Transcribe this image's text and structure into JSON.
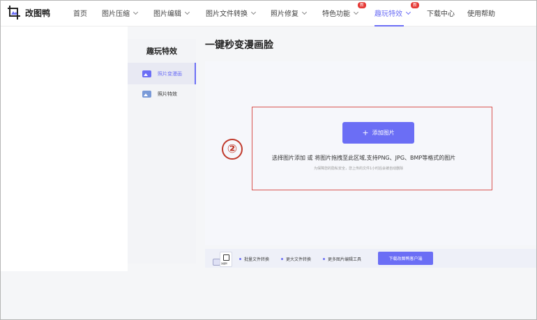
{
  "brand": {
    "name": "改图鸭",
    "logo_icon": "crop-photo-icon"
  },
  "nav": [
    {
      "label": "首页",
      "has_dropdown": false
    },
    {
      "label": "图片压缩",
      "has_dropdown": true
    },
    {
      "label": "图片编辑",
      "has_dropdown": true
    },
    {
      "label": "图片文件转换",
      "has_dropdown": true
    },
    {
      "label": "照片修复",
      "has_dropdown": true
    },
    {
      "label": "特色功能",
      "has_dropdown": true,
      "badge": "新"
    },
    {
      "label": "趣玩特效",
      "has_dropdown": true,
      "badge": "新",
      "active": true
    },
    {
      "label": "下载中心",
      "has_dropdown": false
    },
    {
      "label": "使用帮助",
      "has_dropdown": false
    }
  ],
  "sidebar": {
    "title": "趣玩特效",
    "items": [
      {
        "label": "照片变漫画",
        "icon": "image-icon",
        "active": true
      },
      {
        "label": "照片特效",
        "icon": "image-icon",
        "active": false
      }
    ]
  },
  "main": {
    "title": "一键秒变漫画脸",
    "upload_button": "添加图片",
    "upload_hint": "选择图片添加 或 将图片拖拽至此区域,支持PNG、JPG、BMP等格式的图片",
    "privacy_hint": "为保障您的隐私安全，您上传的文件1小时后会被自动删除",
    "annotation_step": "②"
  },
  "bottom_bar": {
    "app_icon_caption": "改图鸭",
    "features": [
      "批量文件转换",
      "更大文件转换",
      "更多图片编辑工具"
    ],
    "download_button": "下载改图鸭客户端"
  },
  "colors": {
    "accent": "#6b6ef5",
    "badge": "#e53935",
    "annotation": "#c0392b"
  }
}
